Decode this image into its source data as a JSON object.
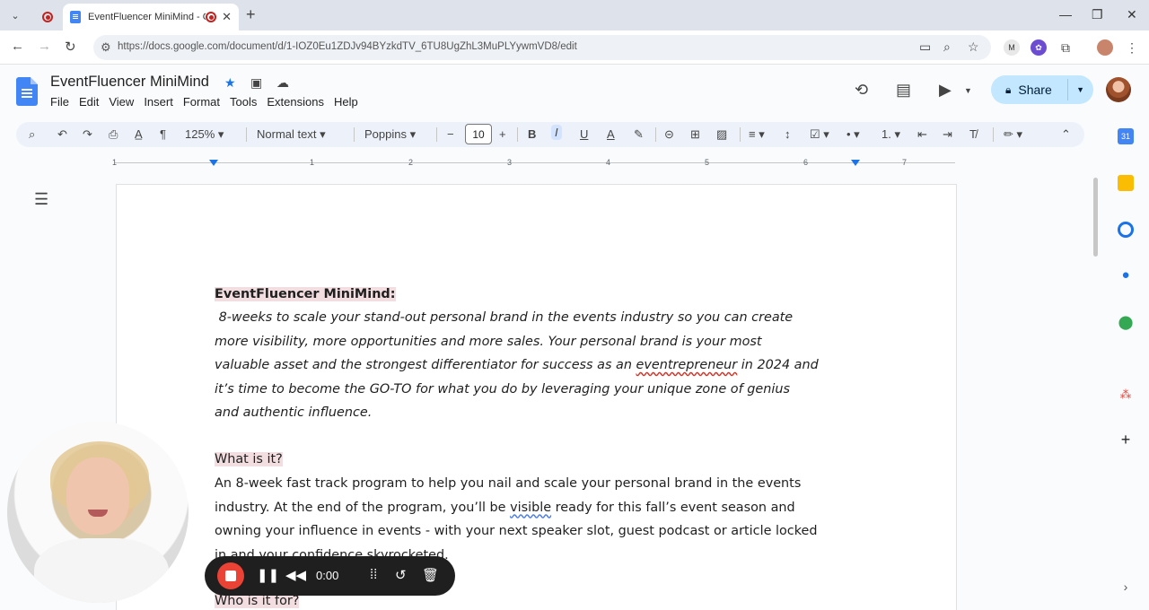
{
  "browser": {
    "tab_title": "EventFluencer MiniMind - G",
    "url": "https://docs.google.com/document/d/1-IOZ0Eu1ZDJv94BYzkdTV_6TU8UgZhL3MuPLYywmVD8/edit"
  },
  "doc": {
    "title": "EventFluencer MiniMind",
    "menu": [
      "File",
      "Edit",
      "View",
      "Insert",
      "Format",
      "Tools",
      "Extensions",
      "Help"
    ],
    "share_label": "Share"
  },
  "toolbar": {
    "zoom": "125%",
    "style": "Normal text",
    "font": "Poppins",
    "font_size": "10"
  },
  "ruler": {
    "numbers": [
      "1",
      "1",
      "2",
      "3",
      "4",
      "5",
      "6",
      "7"
    ]
  },
  "content": {
    "heading1": "EventFluencer MiniMind:",
    "intro_lines": [
      "8-weeks to scale your stand-out personal brand in the events industry so you can create",
      "more visibility, more opportunities and more sales. Your personal brand is your most",
      "valuable asset and the strongest differentiator for success as an ",
      "eventrepreneur",
      " in 2024 and",
      "it’s time to become the GO-TO for what you do by leveraging your unique zone of genius",
      "and authentic influence."
    ],
    "heading2": "What is it?",
    "body_lines": [
      "An 8-week fast track program to help you nail and scale your personal brand in the events",
      "industry. At the end of the program, you’ll be ",
      "visible",
      " ready for this fall’s event season and",
      "owning your influence in events - with your next speaker slot, guest podcast or article locked",
      "in and your confidence skyrocketed."
    ],
    "heading3": "Who is it for?"
  },
  "recorder": {
    "time": "0:00"
  },
  "colors": {
    "accent": "#1a73e8",
    "share_bg": "#c2e7ff",
    "highlight": "#f2dde0",
    "record": "#ea4335"
  }
}
